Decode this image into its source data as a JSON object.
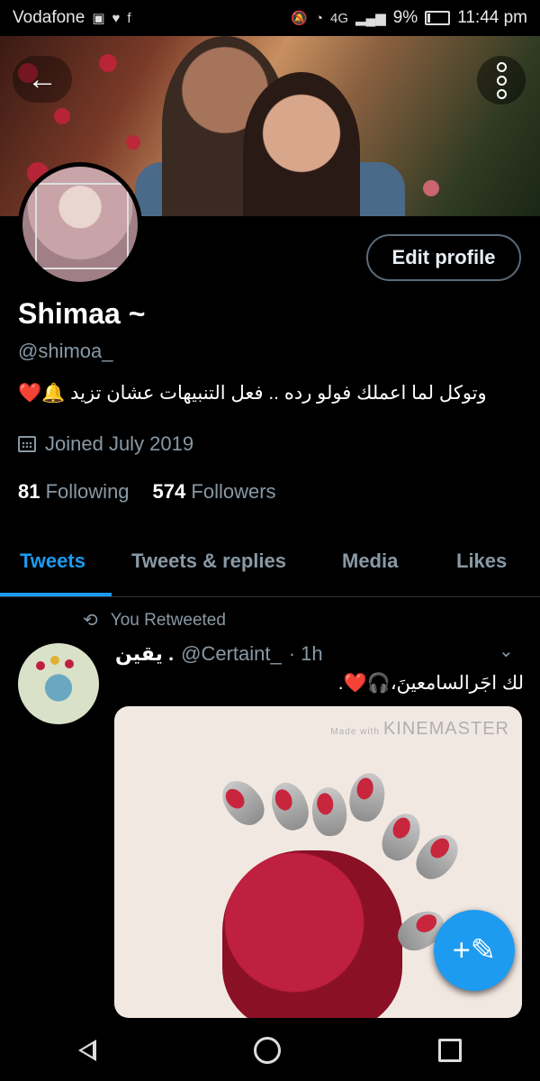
{
  "status_bar": {
    "carrier": "Vodafone",
    "signal_label": "4G",
    "battery": "9%",
    "time": "11:44 pm"
  },
  "profile": {
    "name": "Shimaa ~",
    "handle": "@shimoa_",
    "bio": "وتوكل لما اعملك فولو رده ..  فعل التنبيهات عشان تزيد 🔔❤️",
    "joined": "Joined July 2019",
    "following_count": "81",
    "following_label": "Following",
    "followers_count": "574",
    "followers_label": "Followers",
    "edit_button": "Edit profile"
  },
  "tabs": [
    {
      "label": "Tweets",
      "active": true
    },
    {
      "label": "Tweets & replies",
      "active": false
    },
    {
      "label": "Media",
      "active": false
    },
    {
      "label": "Likes",
      "active": false
    }
  ],
  "tweet": {
    "retweet_label": "You Retweeted",
    "display_name": "يقين .",
    "handle": "@Certaint_",
    "time": "· 1h",
    "text": "لك اجَرالسامعينَ،🎧❤️.",
    "watermark_prefix": "Made with",
    "watermark": "KINEMASTER"
  },
  "colors": {
    "accent": "#1d9bf0",
    "muted": "#8899a6",
    "background": "#000000"
  }
}
